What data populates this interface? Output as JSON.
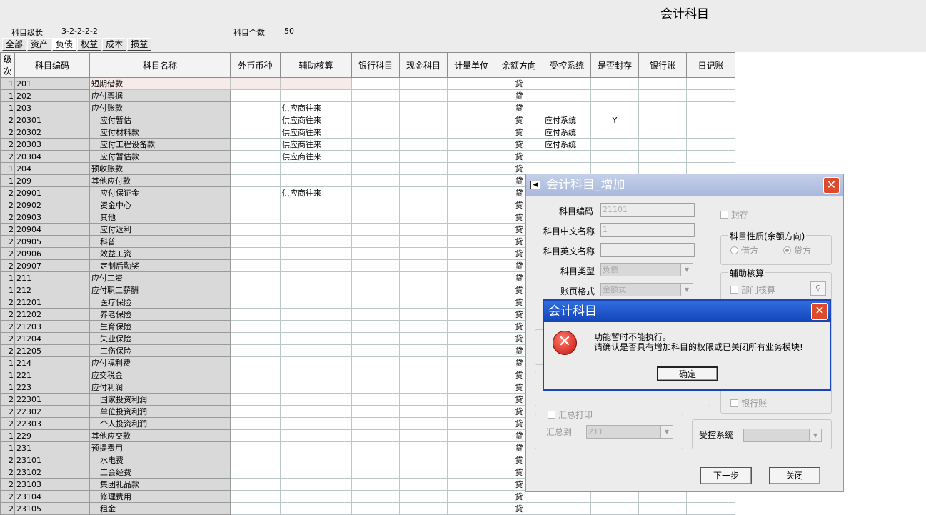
{
  "header": {
    "title": "会计科目",
    "level_label": "科目级长",
    "level_value": "3-2-2-2-2",
    "count_label": "科目个数",
    "count_value": "50"
  },
  "tabs": [
    "全部",
    "资产",
    "负债",
    "权益",
    "成本",
    "损益"
  ],
  "columns": [
    "级次",
    "科目编码",
    "科目名称",
    "外币币种",
    "辅助核算",
    "银行科目",
    "现金科目",
    "计量单位",
    "余额方向",
    "受控系统",
    "是否封存",
    "银行账",
    "日记账"
  ],
  "rows": [
    [
      "1",
      "201",
      "短期借款",
      "",
      "",
      "",
      "",
      "",
      "贷",
      "",
      "",
      "",
      ""
    ],
    [
      "1",
      "202",
      "应付票据",
      "",
      "",
      "",
      "",
      "",
      "贷",
      "",
      "",
      "",
      ""
    ],
    [
      "1",
      "203",
      "应付账款",
      "",
      "供应商往来",
      "",
      "",
      "",
      "贷",
      "",
      "",
      "",
      ""
    ],
    [
      "2",
      "20301",
      "应付暂估",
      "",
      "供应商往来",
      "",
      "",
      "",
      "贷",
      "应付系统",
      "Y",
      "",
      ""
    ],
    [
      "2",
      "20302",
      "应付材料款",
      "",
      "供应商往来",
      "",
      "",
      "",
      "贷",
      "应付系统",
      "",
      "",
      ""
    ],
    [
      "2",
      "20303",
      "应付工程设备款",
      "",
      "供应商往来",
      "",
      "",
      "",
      "贷",
      "应付系统",
      "",
      "",
      ""
    ],
    [
      "2",
      "20304",
      "应付暂估款",
      "",
      "供应商往来",
      "",
      "",
      "",
      "贷",
      "",
      "",
      "",
      ""
    ],
    [
      "1",
      "204",
      "预收账款",
      "",
      "",
      "",
      "",
      "",
      "贷",
      "",
      "",
      "",
      ""
    ],
    [
      "1",
      "209",
      "其他应付款",
      "",
      "",
      "",
      "",
      "",
      "贷",
      "",
      "",
      "",
      ""
    ],
    [
      "2",
      "20901",
      "应付保证金",
      "",
      "供应商往来",
      "",
      "",
      "",
      "贷",
      "",
      "",
      "",
      ""
    ],
    [
      "2",
      "20902",
      "资金中心",
      "",
      "",
      "",
      "",
      "",
      "贷",
      "",
      "",
      "",
      ""
    ],
    [
      "2",
      "20903",
      "其他",
      "",
      "",
      "",
      "",
      "",
      "贷",
      "",
      "",
      "",
      ""
    ],
    [
      "2",
      "20904",
      "应付返利",
      "",
      "",
      "",
      "",
      "",
      "贷",
      "",
      "",
      "",
      ""
    ],
    [
      "2",
      "20905",
      "科普",
      "",
      "",
      "",
      "",
      "",
      "贷",
      "",
      "",
      "",
      ""
    ],
    [
      "2",
      "20906",
      "效益工资",
      "",
      "",
      "",
      "",
      "",
      "贷",
      "",
      "",
      "",
      ""
    ],
    [
      "2",
      "20907",
      "定制后勤奖",
      "",
      "",
      "",
      "",
      "",
      "贷",
      "",
      "",
      "",
      ""
    ],
    [
      "1",
      "211",
      "应付工资",
      "",
      "",
      "",
      "",
      "",
      "贷",
      "",
      "",
      "",
      ""
    ],
    [
      "1",
      "212",
      "应付职工薪酬",
      "",
      "",
      "",
      "",
      "",
      "贷",
      "",
      "",
      "",
      ""
    ],
    [
      "2",
      "21201",
      "医疗保险",
      "",
      "",
      "",
      "",
      "",
      "贷",
      "",
      "",
      "",
      ""
    ],
    [
      "2",
      "21202",
      "养老保险",
      "",
      "",
      "",
      "",
      "",
      "贷",
      "",
      "",
      "",
      ""
    ],
    [
      "2",
      "21203",
      "生育保险",
      "",
      "",
      "",
      "",
      "",
      "贷",
      "",
      "",
      "",
      ""
    ],
    [
      "2",
      "21204",
      "失业保险",
      "",
      "",
      "",
      "",
      "",
      "贷",
      "",
      "",
      "",
      ""
    ],
    [
      "2",
      "21205",
      "工伤保险",
      "",
      "",
      "",
      "",
      "",
      "贷",
      "",
      "",
      "",
      ""
    ],
    [
      "1",
      "214",
      "应付福利费",
      "",
      "",
      "",
      "",
      "",
      "贷",
      "",
      "",
      "",
      ""
    ],
    [
      "1",
      "221",
      "应交税金",
      "",
      "",
      "",
      "",
      "",
      "贷",
      "",
      "",
      "",
      ""
    ],
    [
      "1",
      "223",
      "应付利润",
      "",
      "",
      "",
      "",
      "",
      "贷",
      "",
      "",
      "",
      ""
    ],
    [
      "2",
      "22301",
      "国家投资利润",
      "",
      "",
      "",
      "",
      "",
      "贷",
      "",
      "",
      "",
      ""
    ],
    [
      "2",
      "22302",
      "单位投资利润",
      "",
      "",
      "",
      "",
      "",
      "贷",
      "",
      "",
      "",
      ""
    ],
    [
      "2",
      "22303",
      "个人投资利润",
      "",
      "",
      "",
      "",
      "",
      "贷",
      "",
      "",
      "",
      ""
    ],
    [
      "1",
      "229",
      "其他应交款",
      "",
      "",
      "",
      "",
      "",
      "贷",
      "",
      "",
      "",
      ""
    ],
    [
      "1",
      "231",
      "预提费用",
      "",
      "",
      "",
      "",
      "",
      "贷",
      "",
      "",
      "",
      ""
    ],
    [
      "2",
      "23101",
      "水电费",
      "",
      "",
      "",
      "",
      "",
      "贷",
      "",
      "",
      "",
      ""
    ],
    [
      "2",
      "23102",
      "工会经费",
      "",
      "",
      "",
      "",
      "",
      "贷",
      "",
      "",
      "",
      ""
    ],
    [
      "2",
      "23103",
      "集团礼品款",
      "",
      "",
      "",
      "",
      "",
      "贷",
      "",
      "",
      "",
      ""
    ],
    [
      "2",
      "23104",
      "修理费用",
      "",
      "",
      "",
      "",
      "",
      "贷",
      "",
      "",
      "",
      ""
    ],
    [
      "2",
      "23105",
      "租金",
      "",
      "",
      "",
      "",
      "",
      "贷",
      "",
      "",
      "",
      ""
    ]
  ],
  "add_dialog": {
    "title": "会计科目_增加",
    "code_label": "科目编码",
    "code_value": "21101",
    "cn_label": "科目中文名称",
    "cn_value": "1",
    "en_label": "科目英文名称",
    "type_label": "科目类型",
    "type_value": "负债",
    "fmt_label": "账页格式",
    "fmt_value": "金额式",
    "seal_label": "封存",
    "nature_label": "科目性质(余额方向)",
    "debit_label": "借方",
    "credit_label": "贷方",
    "aux_label": "辅助核算",
    "dept_label": "部门核算",
    "bank_label": "银行账",
    "sum_print_label": "汇总打印",
    "sum_to_label": "汇总到",
    "sum_to_value": "211",
    "ctrl_label": "受控系统",
    "next_label": "下一步",
    "close_label": "关闭"
  },
  "msg_dialog": {
    "title": "会计科目",
    "line1": "功能暂时不能执行。",
    "line2": "请确认是否具有增加科目的权限或已关闭所有业务模块!",
    "ok_label": "确定"
  }
}
